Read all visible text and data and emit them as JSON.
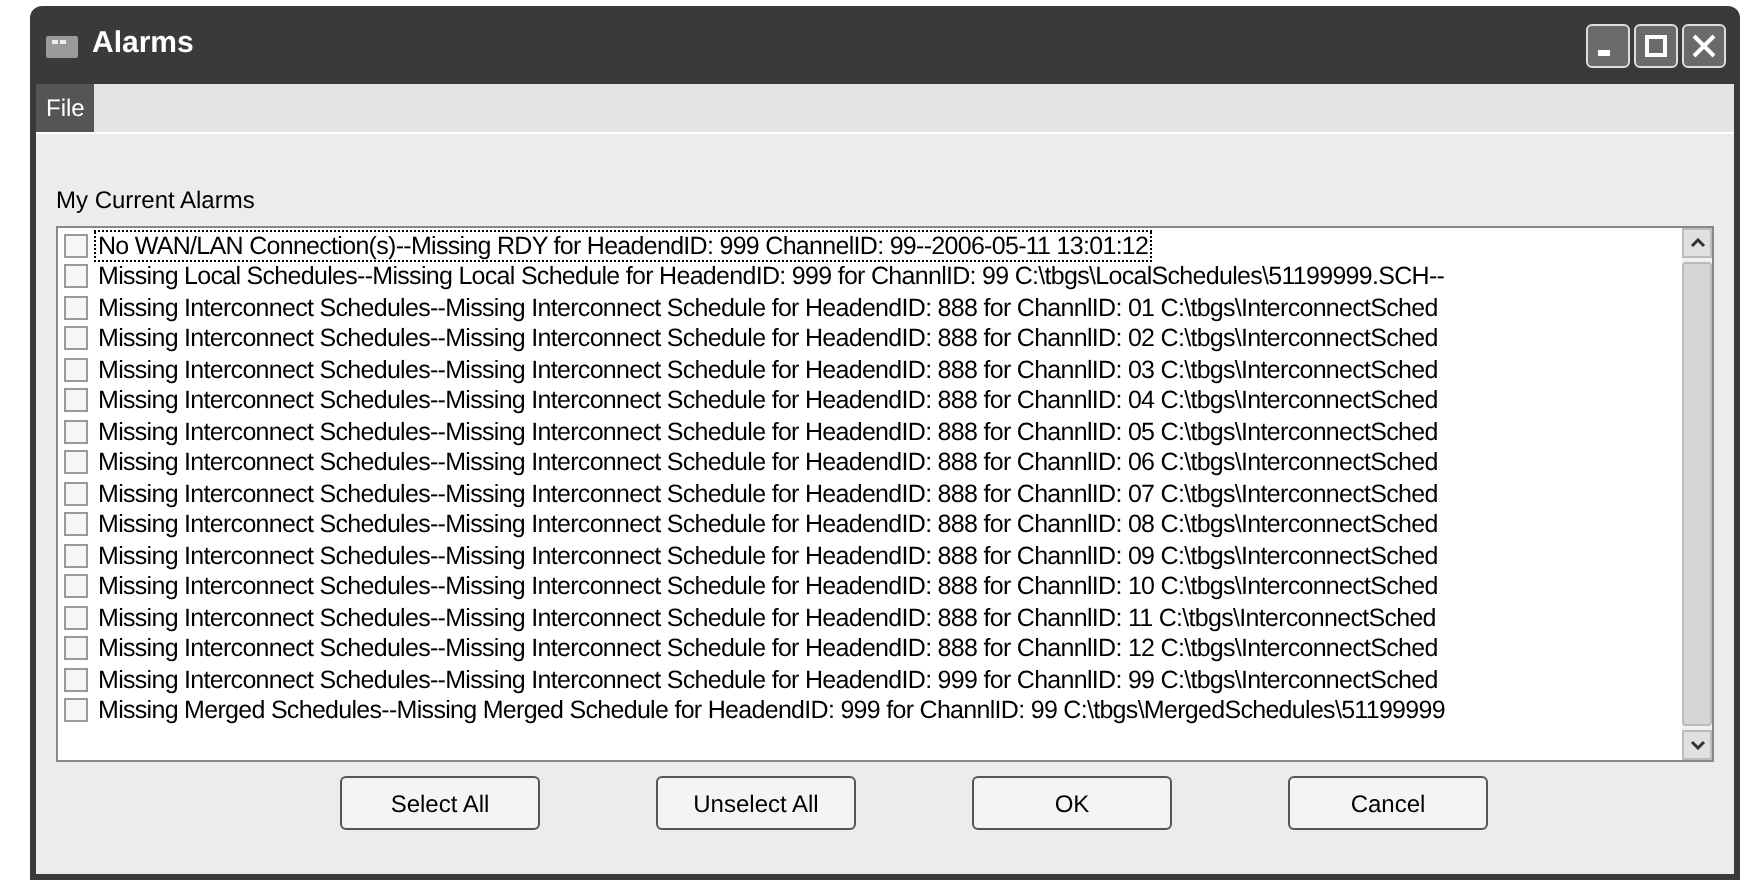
{
  "window": {
    "title": "Alarms"
  },
  "menu": [
    {
      "label": "File",
      "selected": true
    }
  ],
  "list": {
    "label": "My Current Alarms",
    "items": [
      {
        "text": "No WAN/LAN Connection(s)--Missing RDY for HeadendID: 999 ChannelID: 99--2006-05-11 13:01:12",
        "checked": false,
        "selected": true
      },
      {
        "text": "Missing Local Schedules--Missing Local Schedule for HeadendID: 999 for ChannlID: 99 C:\\tbgs\\LocalSchedules\\51199999.SCH--",
        "checked": false,
        "selected": false
      },
      {
        "text": "Missing Interconnect Schedules--Missing Interconnect Schedule for HeadendID: 888 for ChannlID: 01 C:\\tbgs\\InterconnectSched",
        "checked": false,
        "selected": false
      },
      {
        "text": "Missing Interconnect Schedules--Missing Interconnect Schedule for HeadendID: 888 for ChannlID: 02 C:\\tbgs\\InterconnectSched",
        "checked": false,
        "selected": false
      },
      {
        "text": "Missing Interconnect Schedules--Missing Interconnect Schedule for HeadendID: 888 for ChannlID: 03 C:\\tbgs\\InterconnectSched",
        "checked": false,
        "selected": false
      },
      {
        "text": "Missing Interconnect Schedules--Missing Interconnect Schedule for HeadendID: 888 for ChannlID: 04 C:\\tbgs\\InterconnectSched",
        "checked": false,
        "selected": false
      },
      {
        "text": "Missing Interconnect Schedules--Missing Interconnect Schedule for HeadendID: 888 for ChannlID: 05 C:\\tbgs\\InterconnectSched",
        "checked": false,
        "selected": false
      },
      {
        "text": "Missing Interconnect Schedules--Missing Interconnect Schedule for HeadendID: 888 for ChannlID: 06 C:\\tbgs\\InterconnectSched",
        "checked": false,
        "selected": false
      },
      {
        "text": "Missing Interconnect Schedules--Missing Interconnect Schedule for HeadendID: 888 for ChannlID: 07 C:\\tbgs\\InterconnectSched",
        "checked": false,
        "selected": false
      },
      {
        "text": "Missing Interconnect Schedules--Missing Interconnect Schedule for HeadendID: 888 for ChannlID: 08 C:\\tbgs\\InterconnectSched",
        "checked": false,
        "selected": false
      },
      {
        "text": "Missing Interconnect Schedules--Missing Interconnect Schedule for HeadendID: 888 for ChannlID: 09 C:\\tbgs\\InterconnectSched",
        "checked": false,
        "selected": false
      },
      {
        "text": "Missing Interconnect Schedules--Missing Interconnect Schedule for HeadendID: 888 for ChannlID: 10 C:\\tbgs\\InterconnectSched",
        "checked": false,
        "selected": false
      },
      {
        "text": "Missing Interconnect Schedules--Missing Interconnect Schedule for HeadendID: 888 for ChannlID: 11 C:\\tbgs\\InterconnectSched",
        "checked": false,
        "selected": false
      },
      {
        "text": "Missing Interconnect Schedules--Missing Interconnect Schedule for HeadendID: 888 for ChannlID: 12 C:\\tbgs\\InterconnectSched",
        "checked": false,
        "selected": false
      },
      {
        "text": "Missing Interconnect Schedules--Missing Interconnect Schedule for HeadendID: 999 for ChannlID: 99 C:\\tbgs\\InterconnectSched",
        "checked": false,
        "selected": false
      },
      {
        "text": "Missing Merged Schedules--Missing Merged Schedule for HeadendID: 999 for ChannlID: 99 C:\\tbgs\\MergedSchedules\\51199999",
        "checked": false,
        "selected": false
      }
    ]
  },
  "buttons": [
    "Select All",
    "Unselect All",
    "OK",
    "Cancel"
  ]
}
